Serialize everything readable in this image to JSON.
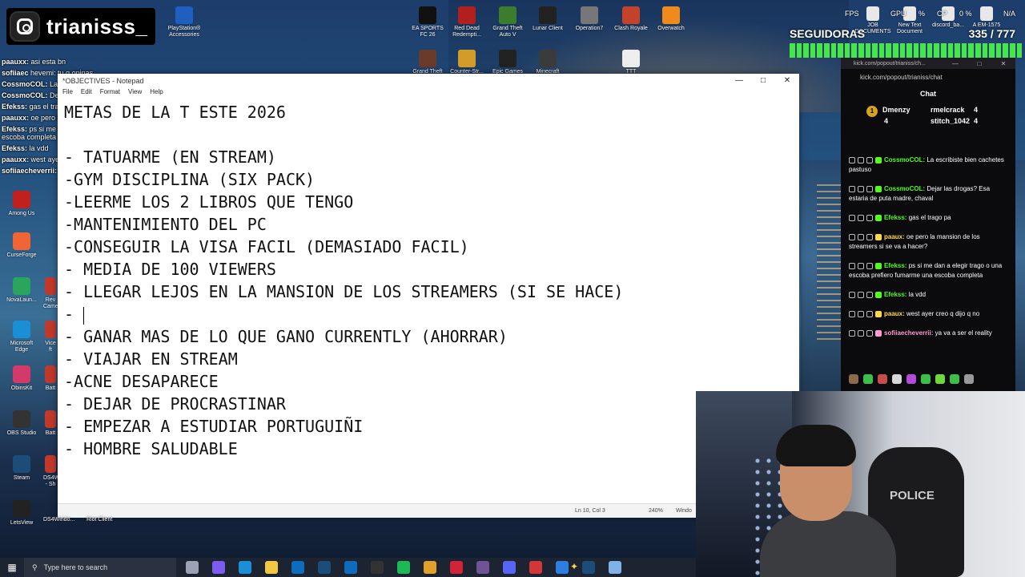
{
  "channel": {
    "name": "trianisss_"
  },
  "hud": {
    "fps_label": "FPS",
    "gpu_label": "GPU",
    "cpu_label": "CP",
    "ram_value": "N/A",
    "gpu_pct": "%",
    "cpu_pct": "0 %",
    "followers_label": "SEGUIDORAS",
    "followers_count": "335 / 777",
    "followers_progress": 0.43
  },
  "desktop_top_icons": [
    {
      "label": "PlayStation®\nAccessories",
      "icon": "playstation-accessories-icon",
      "color": "#1f5fbf"
    },
    {
      "label": "EA SPORTS\nFC 26",
      "icon": "ea-sports-fc-icon",
      "color": "#111"
    },
    {
      "label": "Red Dead\nRedempti...",
      "icon": "red-dead-icon",
      "color": "#b21f1f"
    },
    {
      "label": "Grand Theft\nAuto V",
      "icon": "gta-v-icon",
      "color": "#3c7c2e"
    },
    {
      "label": "Lunar Client",
      "icon": "lunar-client-icon",
      "color": "#222"
    },
    {
      "label": "Operation7",
      "icon": "operation7-icon",
      "color": "#777"
    },
    {
      "label": "Clash Royale",
      "icon": "clash-royale-icon",
      "color": "#c2432a"
    },
    {
      "label": "Overwatch",
      "icon": "overwatch-icon",
      "color": "#f08a1c"
    },
    {
      "label": "Grand Theft",
      "icon": "grand-theft-icon",
      "color": "#6a3a2a"
    },
    {
      "label": "Counter-Str...",
      "icon": "counter-strike-icon",
      "color": "#d39b2a"
    },
    {
      "label": "Epic Games",
      "icon": "epic-games-icon",
      "color": "#222"
    },
    {
      "label": "Minecraft",
      "icon": "minecraft-icon",
      "color": "#3b3b3b"
    },
    {
      "label": "TTT",
      "icon": "ttt-icon",
      "color": "#eee"
    }
  ],
  "desktop_right_icons": [
    {
      "label": "JOB\nDOCUMENTS",
      "icon": "folder-icon"
    },
    {
      "label": "New Text\nDocument",
      "icon": "text-document-icon"
    },
    {
      "label": "discord_ba...",
      "icon": "discord-file-icon"
    },
    {
      "label": "A EM-1575",
      "icon": "file-icon"
    }
  ],
  "desktop_left_icons": [
    {
      "label": "Among Us",
      "icon": "among-us-icon",
      "color": "#c21f1f"
    },
    {
      "label": "CurseForge",
      "icon": "curseforge-icon",
      "color": "#f16436"
    },
    {
      "label": "NovaLaun...",
      "icon": "nova-launcher-icon",
      "color": "#2aa55c"
    },
    {
      "label": "Microsoft\nEdge",
      "icon": "edge-icon",
      "color": "#1a8fd6"
    },
    {
      "label": "ObinsKit",
      "icon": "obinskit-icon",
      "color": "#d23a6a"
    },
    {
      "label": "OBS Studio",
      "icon": "obs-icon",
      "color": "#333"
    },
    {
      "label": "Steam",
      "icon": "steam-icon",
      "color": "#1b4d78"
    },
    {
      "label": "LetsView",
      "icon": "letsview-icon",
      "color": "#222"
    }
  ],
  "desktop_left_labels2": [
    "Rev\nCame",
    "Vice\nft",
    "Batt",
    "Batt",
    "DS4W\n- Sh"
  ],
  "bottom_labels": [
    "DS4Windo...",
    "Riot Client"
  ],
  "overlay_chat": [
    {
      "user": "paauxx:",
      "text": "asi esta bn"
    },
    {
      "user": "sofiiaec",
      "text": "hevemi: tu q opinas"
    },
    {
      "user": "CossmoCOL:",
      "text": "La escribista bien cachetes pastuso"
    },
    {
      "user": "CossmoCOL:",
      "text": "Dejar las drogas? Esa estaria de puta madre, chaval"
    },
    {
      "user": "Efekss:",
      "text": "gas el trago pa"
    },
    {
      "user": "paauxx:",
      "text": "oe pero la mansion de los streamers si se va a hacer?"
    },
    {
      "user": "Efekss:",
      "text": "ps si me dan a elegir trago o una escoba prefiero fumarme una escoba completa"
    },
    {
      "user": "Efekss:",
      "text": "la vdd"
    },
    {
      "user": "paauxx:",
      "text": "west ayer creo q dijo q no"
    },
    {
      "user": "sofiiaecheverrii:",
      "text": "ya va a ser el reality"
    }
  ],
  "notepad": {
    "title": "*OBJECTIVES - Notepad",
    "menu": [
      "File",
      "Edit",
      "Format",
      "View",
      "Help"
    ],
    "lines": [
      "METAS DE LA T ESTE 2026",
      "",
      "- TATUARME (EN STREAM)",
      "-GYM DISCIPLINA (SIX PACK)",
      "-LEERME LOS 2 LIBROS QUE TENGO",
      "-MANTENIMIENTO DEL PC",
      "-CONSEGUIR LA VISA FACIL (DEMASIADO FACIL)",
      "- MEDIA DE 100 VIEWERS",
      "- LLEGAR LEJOS EN LA MANSION DE LOS STREAMERS (SI SE HACE)",
      "- ",
      "- GANAR MAS DE LO QUE GANO CURRENTLY (AHORRAR)",
      "- VIAJAR EN STREAM",
      "-ACNE DESAPARECE",
      "- DEJAR DE PROCRASTINAR",
      "- EMPEZAR A ESTUDIAR PORTUGUIÑI",
      "- HOMBRE SALUDABLE"
    ],
    "caret_line": 9,
    "status_pos": "Ln 10, Col 3",
    "status_zoom": "240%",
    "status_eol": "Windo"
  },
  "chat": {
    "window_title": "kick.com/popout/trianiss/ch...",
    "url": "kick.com/popout/trianiss/chat",
    "header": "Chat",
    "gifters": [
      {
        "name": "Dmenzy",
        "count": "4",
        "rank": "1"
      },
      {
        "name": "rmelcrack",
        "count": "4"
      },
      {
        "name": "stitch_1042",
        "count": "4"
      }
    ],
    "messages": [
      {
        "user": "CossmoCOL:",
        "text": "La escribiste bien cachetes pastuso",
        "color": "#53fc18"
      },
      {
        "user": "CossmoCOL:",
        "text": "Dejar las drogas? Esa estaria de puta madre, chaval",
        "color": "#53fc18"
      },
      {
        "user": "Efekss:",
        "text": "gas el trago pa",
        "color": "#53fc18"
      },
      {
        "user": "paaux:",
        "text": "oe pero la mansion de los streamers si se va a hacer?",
        "color": "#ffd84a"
      },
      {
        "user": "Efekss:",
        "text": "ps si me dan a elegir trago o una escoba prefiero fumarme una escoba completa",
        "color": "#53fc18"
      },
      {
        "user": "Efekss:",
        "text": "la vdd",
        "color": "#53fc18"
      },
      {
        "user": "paaux:",
        "text": "west ayer creo q dijo q no",
        "color": "#ffd84a"
      },
      {
        "user": "sofiiaecheverrii:",
        "text": "ya va a ser el reality",
        "color": "#ff9bd0"
      }
    ]
  },
  "webcam": {
    "chair_text": "POLICE"
  },
  "taskbar": {
    "search_placeholder": "Type here to search",
    "apps": [
      {
        "icon": "task-view-icon",
        "color": "#9aa3b5"
      },
      {
        "icon": "copilot-icon",
        "color": "#7a5cf0"
      },
      {
        "icon": "edge-icon",
        "color": "#1a8fd6"
      },
      {
        "icon": "file-explorer-icon",
        "color": "#f2c744"
      },
      {
        "icon": "outlook-icon",
        "color": "#0f6cbd"
      },
      {
        "icon": "steam-icon",
        "color": "#1b4d78"
      },
      {
        "icon": "microsoft-store-icon",
        "color": "#0f6cbd"
      },
      {
        "icon": "github-icon",
        "color": "#333"
      },
      {
        "icon": "spotify-icon",
        "color": "#1db954"
      },
      {
        "icon": "chrome-icon",
        "color": "#e0a02a"
      },
      {
        "icon": "opera-icon",
        "color": "#d1233a"
      },
      {
        "icon": "github-desktop-icon",
        "color": "#6e5494"
      },
      {
        "icon": "discord-icon",
        "color": "#5865f2"
      },
      {
        "icon": "riot-icon",
        "color": "#d13639"
      },
      {
        "icon": "vpn-icon",
        "color": "#2f7de1"
      },
      {
        "icon": "steam-tray-icon",
        "color": "#1b4d78"
      },
      {
        "icon": "notepad-icon",
        "color": "#7fb2e5"
      }
    ]
  }
}
